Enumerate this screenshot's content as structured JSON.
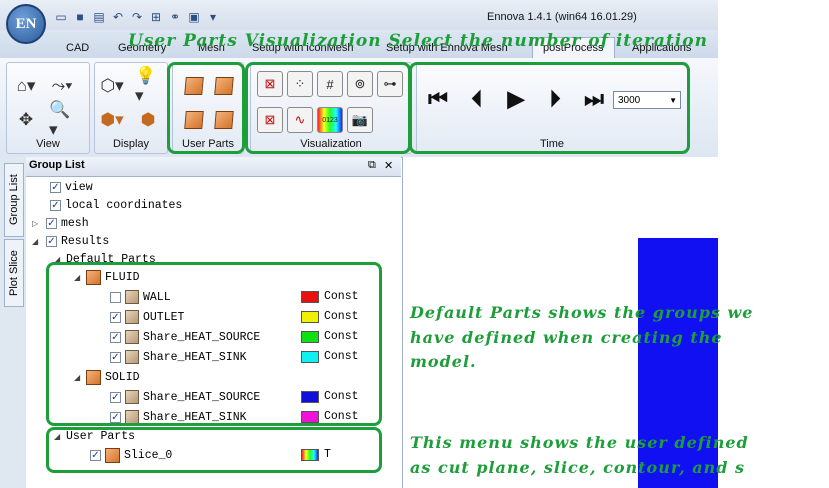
{
  "window": {
    "title": "Ennova 1.4.1 (win64 16.01.29)",
    "logo": "EN"
  },
  "quick_access": [
    "new-icon",
    "save-icon",
    "save-as-icon",
    "undo-icon",
    "redo-icon",
    "grid-icon",
    "link-icon",
    "view-icon",
    "dropdown-icon"
  ],
  "tabs": [
    {
      "label": "CAD"
    },
    {
      "label": "Geometry"
    },
    {
      "label": "Mesh"
    },
    {
      "label": "Setup with iconMesh"
    },
    {
      "label": "Setup with Ennova Mesh"
    },
    {
      "label": "postProcess"
    },
    {
      "label": "Applications"
    }
  ],
  "ribbon": {
    "view_label": "View",
    "display_label": "Display",
    "user_parts_label": "User Parts",
    "visualization_label": "Visualization",
    "time_label": "Time",
    "iteration_value": "3000"
  },
  "annotations": {
    "top": "User Parts  Visualization Select the number of iteration",
    "default_parts_1": "Default Parts shows the groups we",
    "default_parts_2": "have defined when creating the",
    "default_parts_3": "model.",
    "user_parts_1": "This menu shows the user defined",
    "user_parts_2": "as cut plane, slice, contour, and s"
  },
  "side_tabs": {
    "group_list": "Group List",
    "plot_slice": "Plot Slice"
  },
  "panel": {
    "title": "Group List",
    "dock": "⧉",
    "close": "✕"
  },
  "tree": {
    "view": "view",
    "local": "local coordinates",
    "mesh": "mesh",
    "results": "Results",
    "default_parts": "Default Parts",
    "fluid": "FLUID",
    "wall": "WALL",
    "outlet": "OUTLET",
    "fluid_src": "Share_HEAT_SOURCE",
    "fluid_sink": "Share_HEAT_SINK",
    "solid": "SOLID",
    "solid_src": "Share_HEAT_SOURCE",
    "solid_sink": "Share_HEAT_SINK",
    "user_parts": "User Parts",
    "slice": "Slice_0",
    "const": "Const",
    "t": "T"
  },
  "colors": {
    "wall": "#e81010",
    "outlet": "#f0f000",
    "fluid_src": "#10e010",
    "fluid_sink": "#10f0f0",
    "solid_src": "#1010d8",
    "solid_sink": "#f010d8",
    "accent_green": "#1e9e3a"
  }
}
